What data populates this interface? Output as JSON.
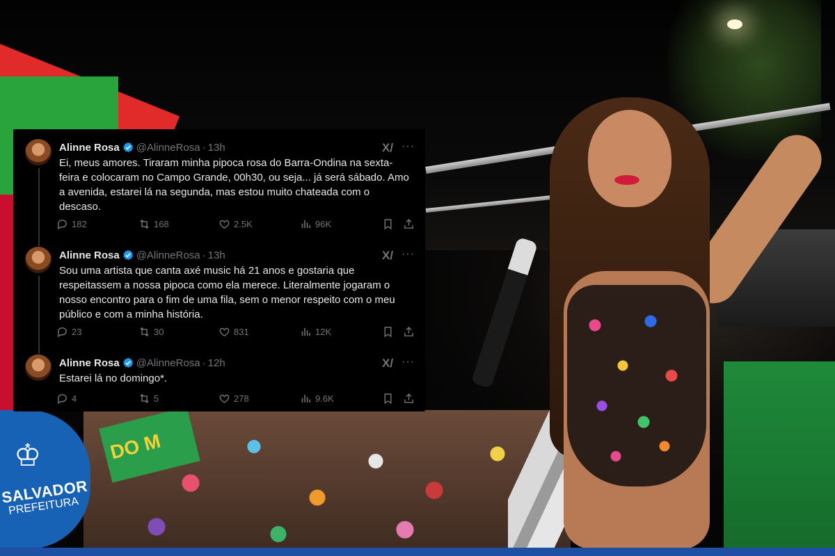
{
  "background": {
    "salvador_logo": {
      "name": "SALVADOR",
      "sub": "PREFEITURA"
    },
    "float_sign_text": "DO M"
  },
  "tweets": [
    {
      "name": "Alinne Rosa",
      "handle": "@AlinneRosa",
      "separator": "·",
      "time": "13h",
      "text": "Ei, meus amores. Tiraram minha pipoca rosa do Barra-Ondina na sexta-feira e colocaram no Campo Grande, 00h30, ou seja... já será sábado. Amo a avenida, estarei lá na segunda, mas estou muito chateada com o descaso.",
      "replies": "182",
      "retweets": "168",
      "likes": "2.5K",
      "views": "96K"
    },
    {
      "name": "Alinne Rosa",
      "handle": "@AlinneRosa",
      "separator": "·",
      "time": "13h",
      "text": "Sou uma artista que canta axé music há 21 anos e gostaria que respeitassem a nossa pipoca como ela merece. Literalmente jogaram o nosso encontro para o fim de uma fila, sem o menor respeito com o meu público e com a minha história.",
      "replies": "23",
      "retweets": "30",
      "likes": "831",
      "views": "12K"
    },
    {
      "name": "Alinne Rosa",
      "handle": "@AlinneRosa",
      "separator": "·",
      "time": "12h",
      "text": "Estarei lá no domingo*.",
      "replies": "4",
      "retweets": "5",
      "likes": "278",
      "views": "9.6K"
    }
  ],
  "icons": {
    "verified": "verified-badge-icon",
    "grok": "grok-icon",
    "more": "more-icon",
    "reply": "reply-icon",
    "retweet": "retweet-icon",
    "like": "heart-icon",
    "views": "views-icon",
    "bookmark": "bookmark-icon",
    "share": "share-icon"
  },
  "colors": {
    "verified": "#1d9bf0",
    "muted": "#71767b",
    "text": "#e7e9ea",
    "card_bg": "#000000"
  }
}
